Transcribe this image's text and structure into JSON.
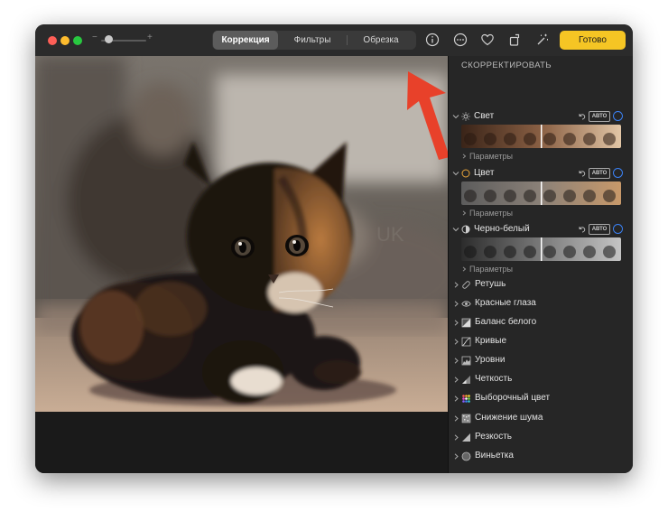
{
  "toolbar": {
    "zoom_minus": "−",
    "zoom_plus": "+",
    "tabs": [
      {
        "label": "Коррекция",
        "selected": true
      },
      {
        "label": "Фильтры",
        "selected": false
      },
      {
        "label": "Обрезка",
        "selected": false
      }
    ],
    "icons": [
      "info-icon",
      "more-icon",
      "heart-icon",
      "rotate-icon",
      "magic-wand-icon"
    ],
    "done_label": "Готово"
  },
  "sidebar": {
    "header": "СКОРРЕКТИРОВАТЬ",
    "expanded_sections": [
      {
        "title": "Свет",
        "icon": "sun-icon",
        "auto_label": "АВТО",
        "params_label": "Параметры",
        "thumb_style": "sepia"
      },
      {
        "title": "Цвет",
        "icon": "color-circle-icon",
        "auto_label": "АВТО",
        "params_label": "Параметры",
        "thumb_style": "mixed"
      },
      {
        "title": "Черно-белый",
        "icon": "bw-circle-icon",
        "auto_label": "АВТО",
        "params_label": "Параметры",
        "thumb_style": "gray"
      }
    ],
    "tools": [
      {
        "label": "Ретушь",
        "icon": "bandage-icon"
      },
      {
        "label": "Красные глаза",
        "icon": "eye-icon"
      },
      {
        "label": "Баланс белого",
        "icon": "white-balance-icon"
      },
      {
        "label": "Кривые",
        "icon": "curves-icon"
      },
      {
        "label": "Уровни",
        "icon": "levels-icon"
      },
      {
        "label": "Четкость",
        "icon": "definition-icon"
      },
      {
        "label": "Выборочный цвет",
        "icon": "selective-color-icon"
      },
      {
        "label": "Снижение шума",
        "icon": "noise-reduction-icon"
      },
      {
        "label": "Резкость",
        "icon": "sharpen-icon"
      },
      {
        "label": "Виньетка",
        "icon": "vignette-icon"
      }
    ]
  },
  "colors": {
    "accent_yellow": "#f5c524",
    "toggle_blue": "#3b82f6",
    "annotation_arrow": "#e8412a"
  }
}
